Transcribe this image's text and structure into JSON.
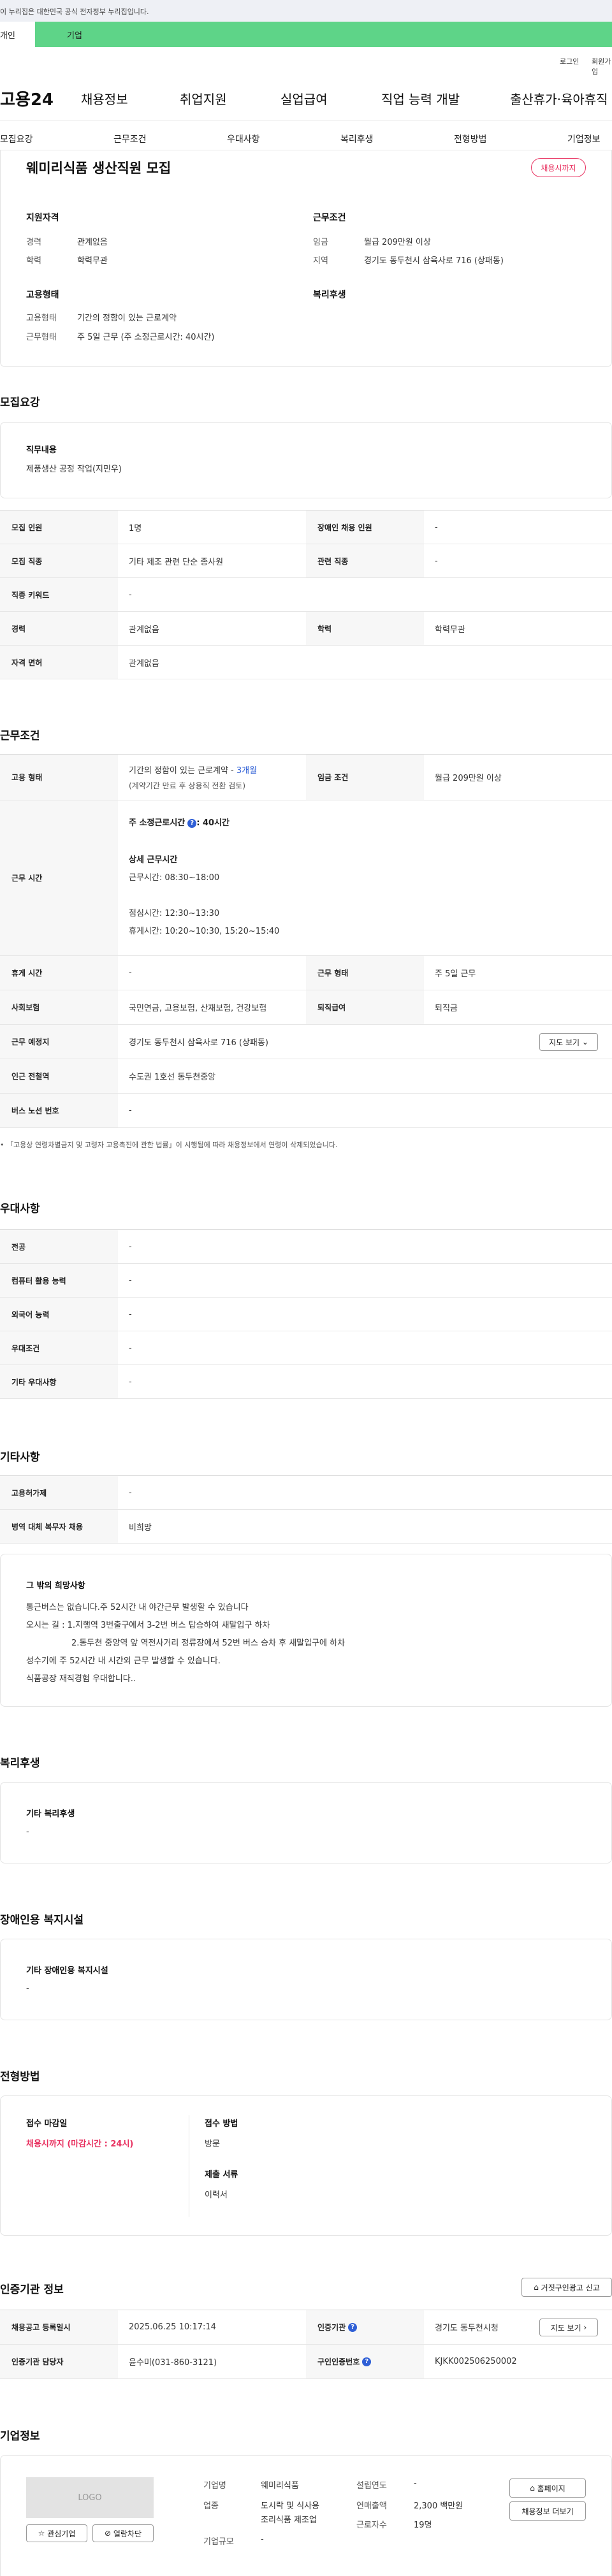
{
  "gov_banner": "이 누리집은 대한민국 공식 전자정부 누리집입니다.",
  "top_tabs": {
    "person": "개인",
    "company": "기업"
  },
  "util_links": {
    "login": "로그인",
    "join": "회원가입"
  },
  "logo": "고용24",
  "gnb": [
    "채용정보",
    "취업지원",
    "실업급여",
    "직업 능력 개발",
    "출산휴가·육아휴직"
  ],
  "subnav": [
    "모집요강",
    "근무조건",
    "우대사항",
    "복리후생",
    "전형방법",
    "기업정보"
  ],
  "summary": {
    "title": "웨미리식품 생산직원 모집",
    "status_badge": "채용시까지",
    "qual_title": "지원자격",
    "career_label": "경력",
    "career_value": "관계없음",
    "edu_label": "학력",
    "edu_value": "학력무관",
    "cond_title": "근무조건",
    "wage_label": "임금",
    "wage_value": "월급 209만원 이상",
    "region_label": "지역",
    "region_value": "경기도 동두천시 삼육사로 716 (상패동)",
    "emp_title": "고용형태",
    "emp_type_label": "고용형태",
    "emp_type_value": "기간의 정함이 있는 근로계약",
    "work_type_label": "근무형태",
    "work_type_value": "주 5일 근무 (주 소정근로시간: 40시간)",
    "welfare_title": "복리후생"
  },
  "recruit": {
    "section_title": "모집요강",
    "job_desc_label": "직무내용",
    "job_desc_value": "제품생산 공정 작업(지민우)",
    "rows": [
      {
        "h1": "모집 인원",
        "v1": "1명",
        "h2": "장애인 채용 인원",
        "v2": "-"
      },
      {
        "h1": "모집 직종",
        "v1": "기타 제조 관련 단순 종사원",
        "h2": "관련 직종",
        "v2": "-"
      },
      {
        "h1": "직종 키워드",
        "v1": "-"
      },
      {
        "h1": "경력",
        "v1": "관계없음",
        "h2": "학력",
        "v2": "학력무관"
      },
      {
        "h1": "자격 면허",
        "v1": "관계없음"
      }
    ]
  },
  "conditions": {
    "section_title": "근무조건",
    "emp_type_label": "고용 형태",
    "emp_type_line1": "기간의 정함이 있는 근로계약 - ",
    "emp_type_months": "3개월",
    "emp_type_line2": "(계약기간 만료 후 상용직 전환 검토)",
    "wage_label": "임금 조건",
    "wage_value": "월급 209만원 이상",
    "hours_label": "근무 시간",
    "hours_std": "주 소정근로시간",
    "hours_std_value": ": 40시간",
    "hours_detail_title": "상세 근무시간",
    "hours_work": "근무시간: 08:30~18:00",
    "hours_lunch": "점심시간: 12:30~13:30",
    "hours_break": "휴게시간: 10:20~10:30, 15:20~15:40",
    "rest_label": "휴게 시간",
    "rest_value": "-",
    "work_form_label": "근무 형태",
    "work_form_value": "주 5일 근무",
    "insurance_label": "사회보험",
    "insurance_value": "국민연금, 고용보험, 산재보험, 건강보험",
    "retire_label": "퇴직급여",
    "retire_value": "퇴직금",
    "location_label": "근무 예정지",
    "location_value": "경기도 동두천시 삼육사로 716 (상패동)",
    "map_button": "지도 보기",
    "subway_label": "인근 전철역",
    "subway_value": "수도권 1호선 동두천중앙",
    "bus_label": "버스 노선 번호",
    "bus_value": "-",
    "notice": "「고용상 연령차별금지 및 고령자 고용촉진에 관한 법률」이 시행됨에 따라 채용정보에서 연령이 삭제되었습니다."
  },
  "preference": {
    "section_title": "우대사항",
    "rows": [
      {
        "h": "전공",
        "v": "-"
      },
      {
        "h": "컴퓨터 활용 능력",
        "v": "-"
      },
      {
        "h": "외국어 능력",
        "v": "-"
      },
      {
        "h": "우대조건",
        "v": "-"
      },
      {
        "h": "기타 우대사항",
        "v": "-"
      }
    ]
  },
  "etc": {
    "section_title": "기타사항",
    "rows": [
      {
        "h": "고용허가제",
        "v": "-"
      },
      {
        "h": "병역 대체 복무자 채용",
        "v": "비희망"
      }
    ],
    "other_title": "그 밖의 희망사항",
    "other_lines": [
      "통근버스는 없습니다.주 52시간 내 야간근무 발생할 수 있습니다",
      "오시는 길 : 1.지행역 3번출구에서 3-2번 버스 탑승하여 새말입구 하차",
      "2.동두천 중앙역 앞 역전사거리 정류장에서 52번 버스 승차 후 새말입구에 하차",
      "성수기에 주 52시간 내 시간외 근무 발생할 수 있습니다.",
      "식품공장 재직경험 우대합니다.."
    ]
  },
  "welfare": {
    "section_title": "복리후생",
    "label": "기타 복리후생",
    "value": "-"
  },
  "disability": {
    "section_title": "장애인용 복지시설",
    "label": "기타 장애인용 복지시설",
    "value": "-"
  },
  "selection": {
    "section_title": "전형방법",
    "deadline_label": "접수 마감일",
    "deadline_value": "채용시까지 (마감시간 : 24시)",
    "method_label": "접수 방법",
    "method_value": "방문",
    "docs_label": "제출 서류",
    "docs_value": "이력서"
  },
  "certification": {
    "section_title": "인증기관 정보",
    "report_button": "거짓구인광고 신고",
    "reg_date_label": "채용공고 등록일시",
    "reg_date_value": "2025.06.25 10:17:14",
    "org_label": "인증기관",
    "org_value": "경기도 동두천시청",
    "map_button": "지도 보기",
    "manager_label": "인증기관 담당자",
    "manager_value": "윤수미(031-860-3121)",
    "cert_no_label": "구인인증번호",
    "cert_no_value": "KJKK002506250002"
  },
  "company": {
    "section_title": "기업정보",
    "logo_text": "LOGO",
    "interest_button": "관심기업",
    "block_button": "열람차단",
    "name_label": "기업명",
    "name_value": "웨미리식품",
    "founded_label": "설립연도",
    "founded_value": "-",
    "industry_label": "업종",
    "industry_value_1": "도시락 및 식사용",
    "industry_value_2": "조리식품 제조업",
    "sales_label": "연매출액",
    "sales_value": "2,300 백만원",
    "employees_label": "근로자수",
    "employees_value": "19명",
    "size_label": "기업규모",
    "size_value": "-",
    "homepage_button": "홈페이지",
    "more_jobs_button": "채용정보 더보기"
  }
}
